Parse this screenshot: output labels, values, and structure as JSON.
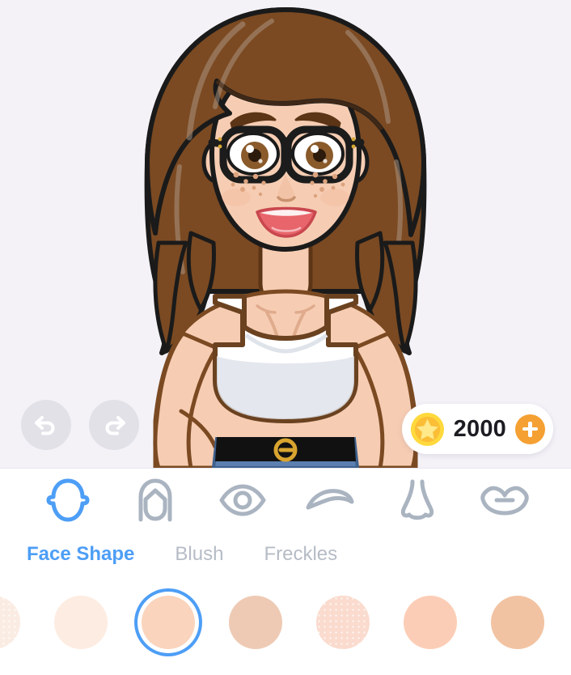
{
  "theme": {
    "canvas_bg": "#f4f2f7",
    "panel_bg": "#ffffff",
    "accent": "#4d9ef6",
    "muted_text": "#b6bcc6",
    "icon_gray": "#aab4c1",
    "coin_gold": "#ffd93d",
    "coin_add_orange": "#f5a033",
    "history_btn_bg": "#e2e1e8"
  },
  "currency": {
    "amount": "2000",
    "coin_icon": "star-coin-icon",
    "add_icon": "plus-icon",
    "add_label": "+"
  },
  "history": {
    "undo_icon": "undo-arrow-icon",
    "redo_icon": "redo-arrow-icon"
  },
  "avatar": {
    "description": "female cartoon avatar, brown wavy shoulder-length hair, black rectangular glasses, brown eyes, freckles, white crop top, blue jeans with black belt",
    "skin": "#f6cdb3",
    "skin_shadow": "#edbb9f",
    "hair": "#7b4a22",
    "hair_dark": "#5c3516",
    "hair_light": "#a8apt",
    "hair_highlight": "#9c8170",
    "outline": "#1a1a1a",
    "eye_brown": "#8a5a2b",
    "eye_dark": "#4a2d13",
    "lips": "#e8656b",
    "lips_dark": "#c9474f",
    "glasses": "#1c1c1c",
    "top_white": "#ffffff",
    "top_shade": "#dfe3ea",
    "jeans": "#5b7fb0",
    "jeans_dark": "#3f608c",
    "belt": "#111111",
    "buckle": "#d9a52f"
  },
  "categories": [
    {
      "id": "face-shape",
      "icon": "face-shape-icon",
      "active": true
    },
    {
      "id": "hair",
      "icon": "hair-icon",
      "active": false
    },
    {
      "id": "eyes",
      "icon": "eye-icon",
      "active": false
    },
    {
      "id": "eyebrows",
      "icon": "eyebrow-icon",
      "active": false
    },
    {
      "id": "nose",
      "icon": "nose-icon",
      "active": false
    },
    {
      "id": "lips",
      "icon": "lips-icon",
      "active": false
    },
    {
      "id": "glasses",
      "icon": "glasses-icon",
      "active": false
    }
  ],
  "tabs": [
    {
      "label": "Face Shape",
      "active": true
    },
    {
      "label": "Blush",
      "active": false
    },
    {
      "label": "Freckles",
      "active": false
    }
  ],
  "swatches": [
    {
      "name": "skin-tone-1",
      "color": "#fbece3",
      "freckled": true,
      "selected": false
    },
    {
      "name": "skin-tone-2",
      "color": "#fdece1",
      "freckled": false,
      "selected": false
    },
    {
      "name": "skin-tone-3",
      "color": "#fad4bc",
      "freckled": false,
      "selected": true
    },
    {
      "name": "skin-tone-4",
      "color": "#eecab4",
      "freckled": false,
      "selected": false
    },
    {
      "name": "skin-tone-5",
      "color": "#fadbce",
      "freckled": true,
      "selected": false
    },
    {
      "name": "skin-tone-6",
      "color": "#fccdb6",
      "freckled": false,
      "selected": false
    },
    {
      "name": "skin-tone-7",
      "color": "#f2c3a2",
      "freckled": false,
      "selected": false
    }
  ]
}
